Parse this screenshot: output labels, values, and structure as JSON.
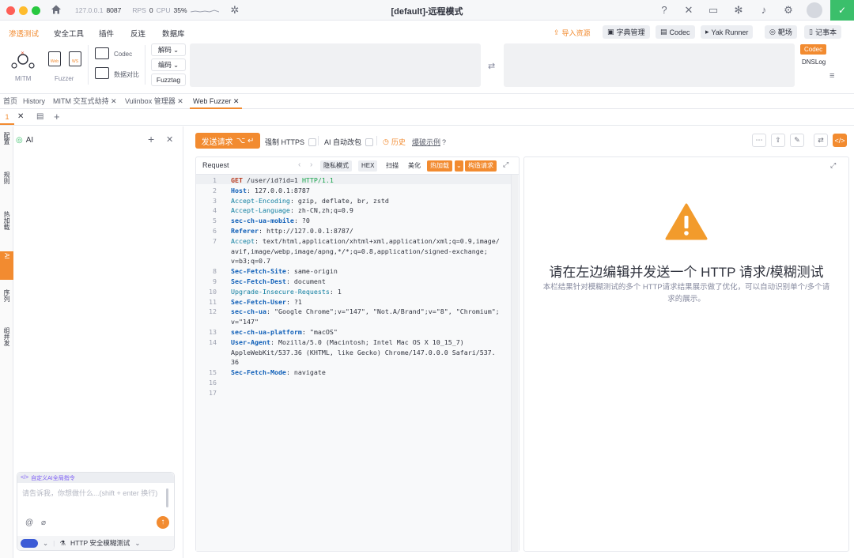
{
  "window": {
    "title": "[default]-远程模式",
    "host": "127.0.0.1",
    "port": "8087",
    "rps_label": "RPS",
    "rps_value": "0",
    "cpu_label": "CPU",
    "cpu_value": "35%"
  },
  "menu": {
    "items": [
      "渗透测试",
      "安全工具",
      "插件",
      "反连",
      "数据库"
    ],
    "right_buttons": [
      "导入资源",
      "字典管理",
      "Codec",
      "Yak Runner",
      "靶场",
      "记事本"
    ]
  },
  "ribbon": {
    "mitm": "MITM",
    "fuzzer": "Fuzzer",
    "web_label": "Web",
    "ws_label": "WS",
    "codec": "Codec",
    "compare": "数据对比",
    "decode": "解码",
    "encode": "编码",
    "fuzztag": "Fuzztag",
    "codec_tag": "Codec",
    "dnslog_tag": "DNSLog"
  },
  "tabs": [
    "首页",
    "History",
    "MITM 交互式劫持",
    "Vulinbox 管理器",
    "Web Fuzzer"
  ],
  "subtab": "1",
  "rail": [
    "配置",
    "规则",
    "热加载",
    "AI",
    "序列",
    "组并发"
  ],
  "ai_panel": {
    "title": "AI",
    "custom_label": "自定义AI全局指令",
    "placeholder": "请告诉我，你想做什么...(shift + enter 换行)",
    "mode": "HTTP 安全模糊测试"
  },
  "toolbar": {
    "send": "发送请求",
    "send_shortcut": "⌥ ↵",
    "force_https": "强制 HTTPS",
    "ai_modify": "AI 自动改包",
    "history": "历史",
    "demo": "爆破示例"
  },
  "request": {
    "title": "Request",
    "buttons": [
      "隐私模式",
      "HEX",
      "扫描",
      "美化",
      "热加载",
      "构造请求"
    ],
    "lines": [
      {
        "n": "1",
        "text": "GET /user/id?id=1 HTTP/1.1"
      },
      {
        "n": "2",
        "text": "Host: 127.0.0.1:8787"
      },
      {
        "n": "3",
        "text": "Accept-Encoding: gzip, deflate, br, zstd"
      },
      {
        "n": "4",
        "text": "Accept-Language: zh-CN,zh;q=0.9"
      },
      {
        "n": "5",
        "text": "sec-ch-ua-mobile: ?0"
      },
      {
        "n": "6",
        "text": "Referer: http://127.0.0.1:8787/"
      },
      {
        "n": "7",
        "text": "Accept: text/html,application/xhtml+xml,application/xml;q=0.9,image/"
      },
      {
        "n": "",
        "text": "avif,image/webp,image/apng,*/*;q=0.8,application/signed-exchange;"
      },
      {
        "n": "",
        "text": "v=b3;q=0.7"
      },
      {
        "n": "8",
        "text": "Sec-Fetch-Site: same-origin"
      },
      {
        "n": "9",
        "text": "Sec-Fetch-Dest: document"
      },
      {
        "n": "10",
        "text": "Upgrade-Insecure-Requests: 1"
      },
      {
        "n": "11",
        "text": "Sec-Fetch-User: ?1"
      },
      {
        "n": "12",
        "text": "sec-ch-ua: \"Google Chrome\";v=\"147\", \"Not.A/Brand\";v=\"8\", \"Chromium\";"
      },
      {
        "n": "",
        "text": "v=\"147\""
      },
      {
        "n": "13",
        "text": "sec-ch-ua-platform: \"macOS\""
      },
      {
        "n": "14",
        "text": "User-Agent: Mozilla/5.0 (Macintosh; Intel Mac OS X 10_15_7)"
      },
      {
        "n": "",
        "text": "AppleWebKit/537.36 (KHTML, like Gecko) Chrome/147.0.0.0 Safari/537."
      },
      {
        "n": "",
        "text": "36"
      },
      {
        "n": "15",
        "text": "Sec-Fetch-Mode: navigate"
      },
      {
        "n": "16",
        "text": ""
      },
      {
        "n": "17",
        "text": ""
      }
    ]
  },
  "response": {
    "title": "请在左边编辑并发送一个 HTTP 请求/模糊测试",
    "desc": "本栏结果针对模糊测试的多个 HTTP请求结果展示做了优化，可以自动识别单个/多个请求的展示。"
  },
  "colors": {
    "accent": "#f28b30",
    "warning": "#f29b2c",
    "safe": "#3bbf6b"
  }
}
